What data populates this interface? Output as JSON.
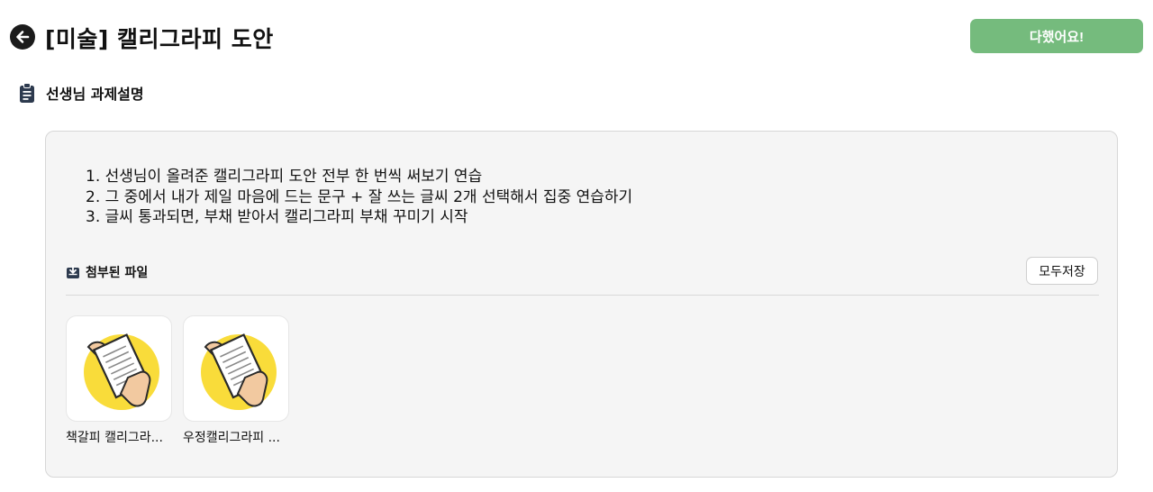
{
  "header": {
    "back_icon": "arrow-left-circle-icon",
    "title": "[미술] 캘리그라피 도안",
    "done_label": "다했어요!",
    "done_color": "#75bb7d"
  },
  "description_section": {
    "icon": "clipboard-icon",
    "title": "선생님 과제설명",
    "steps": [
      "1. 선생님이 올려준 캘리그라피 도안 전부 한 번씩 써보기 연습",
      "2. 그 중에서 내가 제일 마음에 드는 문구 + 잘 쓰는 글씨 2개 선택해서 집중 연습하기",
      "3. 글씨 통과되면, 부채 받아서 캘리그라피 부채 꾸미기 시작"
    ]
  },
  "attachments": {
    "icon": "tray-download-icon",
    "title": "첨부된 파일",
    "save_all_label": "모두저장",
    "files": [
      {
        "name": "책갈피 캘리그라...",
        "thumbnail_icon": "document-hand-icon"
      },
      {
        "name": "우정캘리그라피 ...",
        "thumbnail_icon": "document-hand-icon"
      }
    ],
    "thumbnail_accent": "#f9dc3a"
  }
}
